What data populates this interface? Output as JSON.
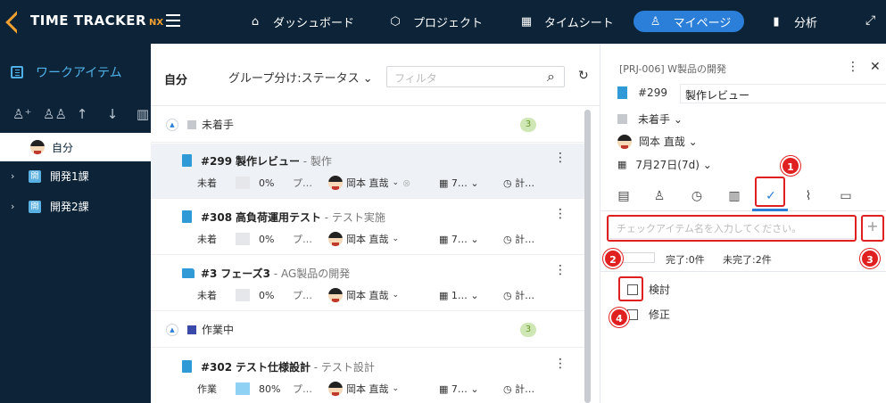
{
  "app": {
    "logo_text": "TIME TRACKER",
    "logo_suffix": "NX"
  },
  "nav": {
    "dashboard": "ダッシュボード",
    "project": "プロジェクト",
    "timesheet": "タイムシート",
    "mypage": "マイページ",
    "analysis": "分析"
  },
  "sidebar": {
    "title": "ワークアイテム",
    "self": "自分",
    "groups": [
      {
        "label": "開発1課",
        "icon_text": "開"
      },
      {
        "label": "開発2課",
        "icon_text": "開"
      }
    ]
  },
  "list": {
    "title": "自分",
    "group_by": "グループ分け:ステータス",
    "filter_placeholder": "フィルタ",
    "groups": [
      {
        "label": "未着手",
        "count": "3",
        "color": "#c5c9ce"
      },
      {
        "label": "作業中",
        "count": "3",
        "color": "#3a4aa8"
      }
    ],
    "items": [
      {
        "id": "#299",
        "name": "製作レビュー",
        "sub": " - 製作",
        "status": "未着",
        "percent": "0%",
        "pu": "プ…",
        "user": "岡本 直哉",
        "date": "7…",
        "plan": "計…"
      },
      {
        "id": "#308",
        "name": "高負荷運用テスト",
        "sub": " - テスト実施",
        "status": "未着",
        "percent": "0%",
        "pu": "プ…",
        "user": "岡本 直哉",
        "date": "7…",
        "plan": "計…"
      },
      {
        "id": "#3",
        "name": "フェーズ3",
        "sub": " - AG製品の開発",
        "status": "未着",
        "percent": "0%",
        "pu": "プ…",
        "user": "岡本 直哉",
        "date": "1…",
        "plan": "計…"
      },
      {
        "id": "#302",
        "name": "テスト仕様設計",
        "sub": " - テスト設計",
        "status": "作業",
        "percent": "80%",
        "pu": "プ…",
        "user": "岡本 直哉",
        "date": "7…",
        "plan": "計…"
      }
    ]
  },
  "detail": {
    "crumb": "[PRJ-006] W製品の開発",
    "id": "#299",
    "name": "製作レビュー",
    "status": "未着手",
    "user": "岡本 直哉",
    "date": "7月27日(7d)",
    "checklist": {
      "placeholder": "チェックアイテム名を入力してください。",
      "done": "完了:0件",
      "undone": "未完了:2件",
      "items": [
        {
          "label": "検討"
        },
        {
          "label": "修正"
        }
      ]
    }
  },
  "annotations": [
    "1",
    "2",
    "3",
    "4"
  ],
  "colors": {
    "nav_bg": "#0d2438",
    "accent": "#2b7fd8",
    "annotation": "#e02020"
  }
}
